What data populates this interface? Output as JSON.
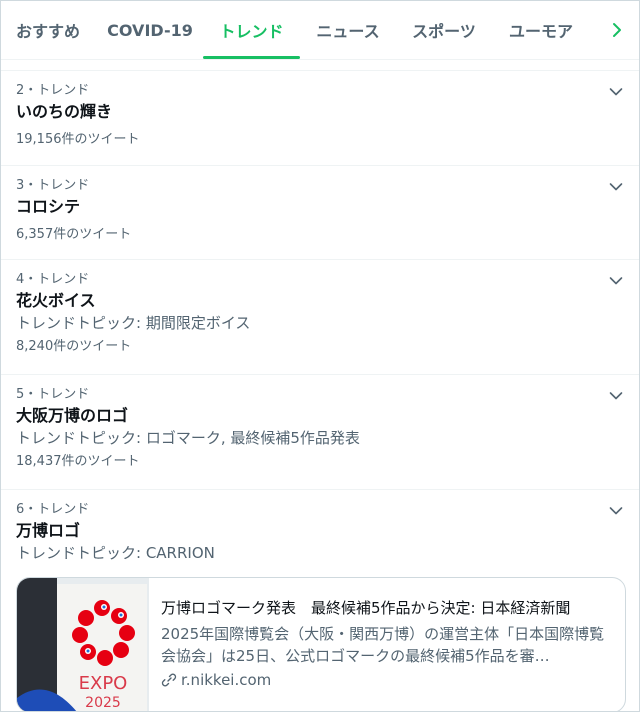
{
  "tabs": [
    {
      "label": "おすすめ",
      "active": false
    },
    {
      "label": "COVID-19",
      "active": false
    },
    {
      "label": "トレンド",
      "active": true
    },
    {
      "label": "ニュース",
      "active": false
    },
    {
      "label": "スポーツ",
      "active": false
    },
    {
      "label": "ユーモア",
      "active": false
    }
  ],
  "accent_color": "#17bf63",
  "trends": [
    {
      "meta": "2・トレンド",
      "name": "いのちの輝き",
      "topic": "",
      "count": "19,156件のツイート"
    },
    {
      "meta": "3・トレンド",
      "name": "コロシテ",
      "topic": "",
      "count": "6,357件のツイート"
    },
    {
      "meta": "4・トレンド",
      "name": "花火ボイス",
      "topic": "トレンドトピック: 期間限定ボイス",
      "count": "8,240件のツイート"
    },
    {
      "meta": "5・トレンド",
      "name": "大阪万博のロゴ",
      "topic": "トレンドトピック: ロゴマーク, 最終候補5作品発表",
      "count": "18,437件のツイート"
    },
    {
      "meta": "6・トレンド",
      "name": "万博ロゴ",
      "topic": "トレンドトピック: CARRION",
      "count": ""
    }
  ],
  "card": {
    "title": "万博ロゴマーク発表　最終候補5作品から決定: 日本経済新聞",
    "description": "2025年国際博覧会（大阪・関西万博）の運営主体「日本国際博覧会協会」は25日、公式ロゴマークの最終候補5作品を審…",
    "domain": "r.nikkei.com",
    "thumb_text_top": "EXPO",
    "thumb_text_bottom": "2025"
  }
}
